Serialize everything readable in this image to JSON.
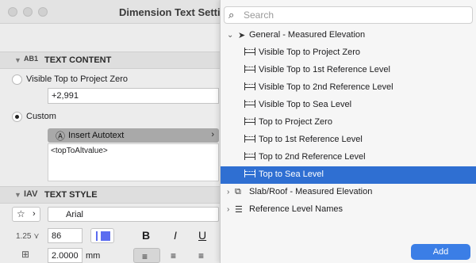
{
  "window": {
    "title": "Dimension Text Settings"
  },
  "text_content": {
    "section_title": "TEXT CONTENT",
    "section_icon": "AB1",
    "option_visible_top": "Visible Top to Project Zero",
    "value_field": "+2,991",
    "option_custom": "Custom",
    "insert_autotext": "Insert Autotext",
    "autotext_value": "<topToAltvalue>"
  },
  "text_style": {
    "section_title": "TEXT STYLE",
    "font_name": "Arial",
    "size_value": "86",
    "size_prefix": "1.25",
    "spacing_value": "2.0000",
    "spacing_unit": "mm",
    "bold_label": "B",
    "italic_label": "I",
    "underline_label": "U"
  },
  "popover": {
    "search_placeholder": "Search",
    "groups": [
      {
        "label": "General - Measured Elevation",
        "expanded": true,
        "items": [
          "Visible Top to Project Zero",
          "Visible Top to 1st Reference Level",
          "Visible Top to 2nd Reference Level",
          "Visible Top to Sea Level",
          "Top to Project Zero",
          "Top to 1st Reference Level",
          "Top to 2nd Reference Level",
          "Top to Sea Level"
        ],
        "selected_item": "Top to Sea Level"
      },
      {
        "label": "Slab/Roof - Measured Elevation",
        "expanded": false
      },
      {
        "label": "Reference Level Names",
        "expanded": false
      }
    ],
    "add_button": "Add"
  },
  "colors": {
    "selection": "#2f6fd2",
    "add_button": "#3b7ee6",
    "swatch": "#5b6cf0"
  }
}
